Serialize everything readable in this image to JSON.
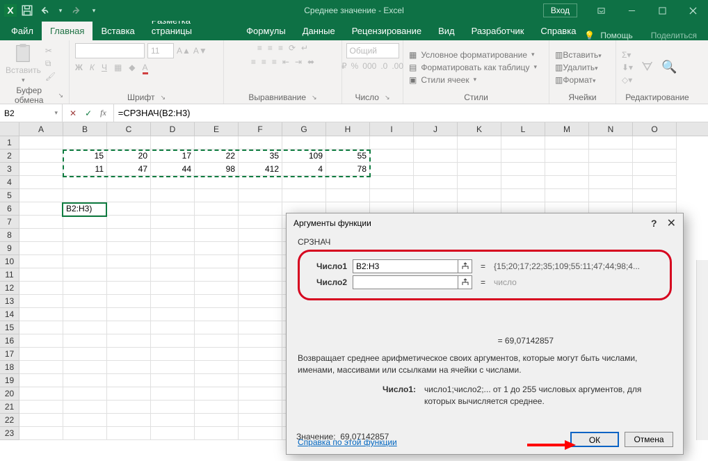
{
  "title": "Среднее значение  -  Excel",
  "login_label": "Вход",
  "tabs": {
    "file": "Файл",
    "home": "Главная",
    "insert": "Вставка",
    "layout": "Разметка страницы",
    "formulas": "Формулы",
    "data": "Данные",
    "review": "Рецензирование",
    "view": "Вид",
    "developer": "Разработчик",
    "help": "Справка"
  },
  "tell_me": "Помощь",
  "share": "Поделиться",
  "groups": {
    "clipboard": "Буфер обмена",
    "font": "Шрифт",
    "alignment": "Выравнивание",
    "number": "Число",
    "styles": "Стили",
    "cells": "Ячейки",
    "editing": "Редактирование"
  },
  "paste_label": "Вставить",
  "font_size": "11",
  "number_format": "Общий",
  "styles_items": {
    "cond": "Условное форматирование",
    "table": "Форматировать как таблицу",
    "cell": "Стили ячеек"
  },
  "cells_items": {
    "insert": "Вставить",
    "delete": "Удалить",
    "format": "Формат"
  },
  "namebox": "B2",
  "formula": "=СРЗНАЧ(B2:H3)",
  "columns": [
    "A",
    "B",
    "C",
    "D",
    "E",
    "F",
    "G",
    "H",
    "I",
    "J",
    "K",
    "L",
    "M",
    "N",
    "O"
  ],
  "rows": [
    "1",
    "2",
    "3",
    "4",
    "5",
    "6",
    "7",
    "8",
    "9",
    "10",
    "11",
    "12",
    "13",
    "14",
    "15",
    "16",
    "17",
    "18",
    "19",
    "20",
    "21",
    "22",
    "23"
  ],
  "data_rows": [
    {
      "r": 2,
      "cells": {
        "B": "15",
        "C": "20",
        "D": "17",
        "E": "22",
        "F": "35",
        "G": "109",
        "H": "55"
      }
    },
    {
      "r": 3,
      "cells": {
        "B": "11",
        "C": "47",
        "D": "44",
        "E": "98",
        "F": "412",
        "G": "4",
        "H": "78"
      }
    }
  ],
  "cell_b6": "B2:H3)",
  "dialog": {
    "title": "Аргументы функции",
    "fn": "СРЗНАЧ",
    "arg1_label": "Число1",
    "arg1_value": "B2:H3",
    "arg1_result": "{15;20;17;22;35;109;55:11;47;44;98;4...",
    "arg2_label": "Число2",
    "arg2_value": "",
    "arg2_result": "число",
    "calc_result": "=   69,07142857",
    "desc": "Возвращает среднее арифметическое своих аргументов, которые могут быть числами, именами, массивами или ссылками на ячейки с числами.",
    "arg_hint_label": "Число1:",
    "arg_hint": "число1;число2;... от 1 до 255 числовых аргументов, для которых вычисляется среднее.",
    "value_label": "Значение:",
    "value": "69,07142857",
    "help": "Справка по этой функции",
    "ok": "ОК",
    "cancel": "Отмена"
  }
}
